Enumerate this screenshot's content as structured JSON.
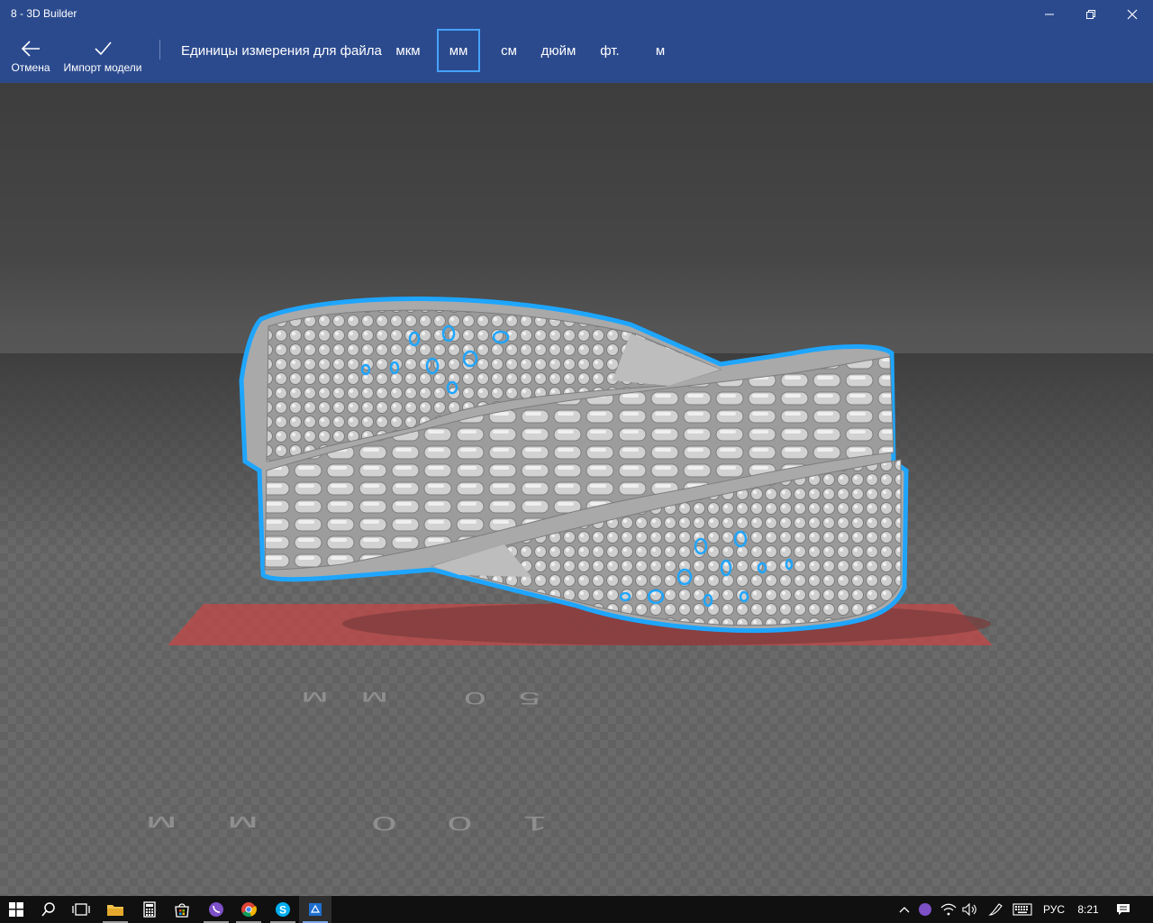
{
  "window": {
    "title": "8 - 3D Builder"
  },
  "commandbar": {
    "cancel_label": "Отмена",
    "import_label": "Импорт модели",
    "units_label": "Единицы измерения для файла",
    "units": [
      "мкм",
      "мм",
      "см",
      "дюйм",
      "фт.",
      "м"
    ],
    "selected_unit": "мм"
  },
  "viewport": {
    "ruler_label_50": "50 мм",
    "ruler_label_100": "100 мм",
    "model_outline_color": "#1ea6ff",
    "plate_color": "#b84a4a"
  },
  "taskbar": {
    "apps": [
      "start-icon",
      "search-icon",
      "task-view-icon",
      "file-explorer-icon",
      "calculator-icon",
      "store-icon",
      "viber-icon",
      "chrome-icon",
      "skype-icon",
      "3d-builder-icon"
    ],
    "language": "РУС",
    "time": "8:21"
  },
  "colors": {
    "accent_bar": "#2b4a8e",
    "selection": "#45a3ff",
    "taskbar": "#101010"
  }
}
